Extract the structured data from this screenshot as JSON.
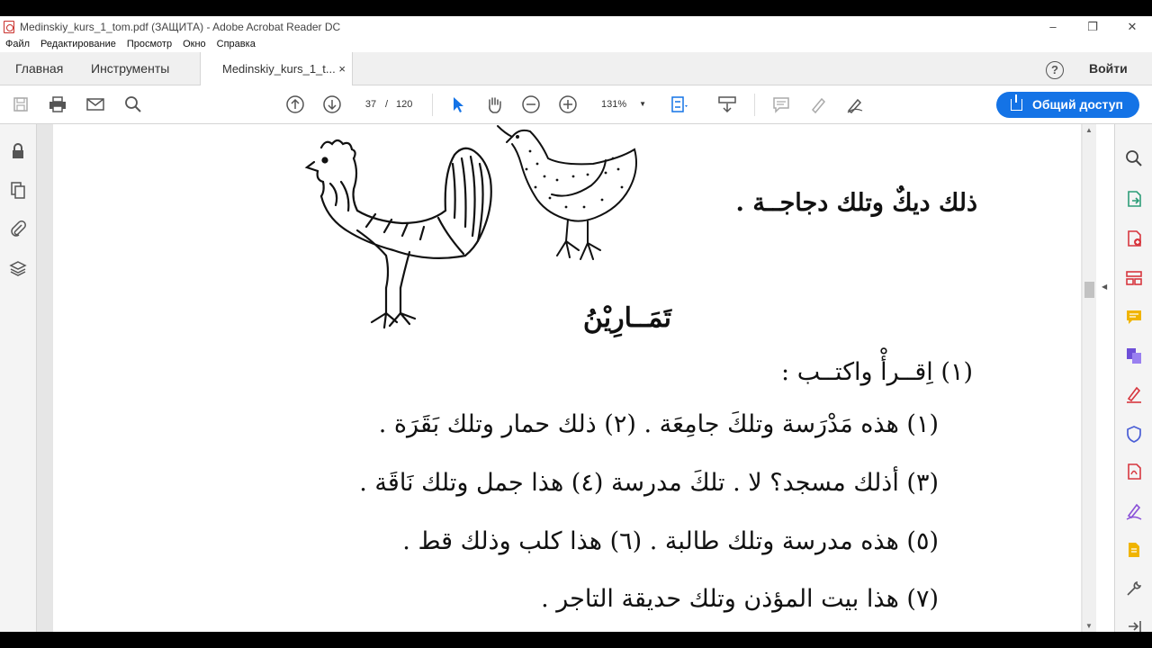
{
  "window": {
    "title": "Medinskiy_kurs_1_tom.pdf (ЗАЩИТА) - Adobe Acrobat Reader DC",
    "controls": [
      "–",
      "❐",
      "✕"
    ]
  },
  "menu": [
    "Файл",
    "Редактирование",
    "Просмотр",
    "Окно",
    "Справка"
  ],
  "tabs": {
    "home": "Главная",
    "tools": "Инструменты",
    "document": "Medinskiy_kurs_1_t...",
    "close": "×"
  },
  "header": {
    "help": "?",
    "signin": "Войти"
  },
  "toolbar": {
    "current_page": "37",
    "page_sep": "/",
    "total_pages": "120",
    "zoom": "131%",
    "share_label": "Общий доступ"
  },
  "scrollbar": {
    "position_fraction": 0.31
  },
  "document": {
    "caption": "ذلك ديكٌ وتلك دجاجــة .",
    "exercises_title": "تَمَــارِيْنُ",
    "task1": "(١) اِقــرأْ واكتــب :",
    "lines": [
      "(١) هذه مَدْرَسة وتلكَ جامِعَة .     (٢) ذلك حمار وتلك بَقَرَة .",
      "(٣) أذلك مسجد؟ لا . تلكَ مدرسة (٤) هذا جمل وتلك نَاقَة .",
      "(٥) هذه مدرسة وتلك طالبة .       (٦) هذا كلب وذلك قط .",
      "(٧) هذا بيت المؤذن وتلك حديقة التاجر ."
    ]
  },
  "colors": {
    "accent": "#1473e6",
    "pdf_red": "#c9302c"
  },
  "icons": {
    "toolbar": [
      "save-icon",
      "print-icon",
      "email-icon",
      "search-icon",
      "prev-page-icon",
      "next-page-icon",
      "select-cursor-icon",
      "hand-icon",
      "zoom-out-icon",
      "zoom-in-icon",
      "fit-page-icon",
      "scroll-mode-icon",
      "comment-icon",
      "highlight-icon",
      "sign-icon"
    ],
    "left_rail": [
      "lock-icon",
      "pages-icon",
      "attachment-icon",
      "layers-icon"
    ],
    "right_rail": [
      "search-panel-icon",
      "export-pdf-icon",
      "create-pdf-icon",
      "organize-pages-icon",
      "comment-tool-icon",
      "combine-files-icon",
      "fill-sign-icon",
      "protect-icon",
      "acrobat-pdf-icon",
      "edit-pdf-icon",
      "send-review-icon",
      "more-tools-icon",
      "expand-panel-icon"
    ]
  }
}
